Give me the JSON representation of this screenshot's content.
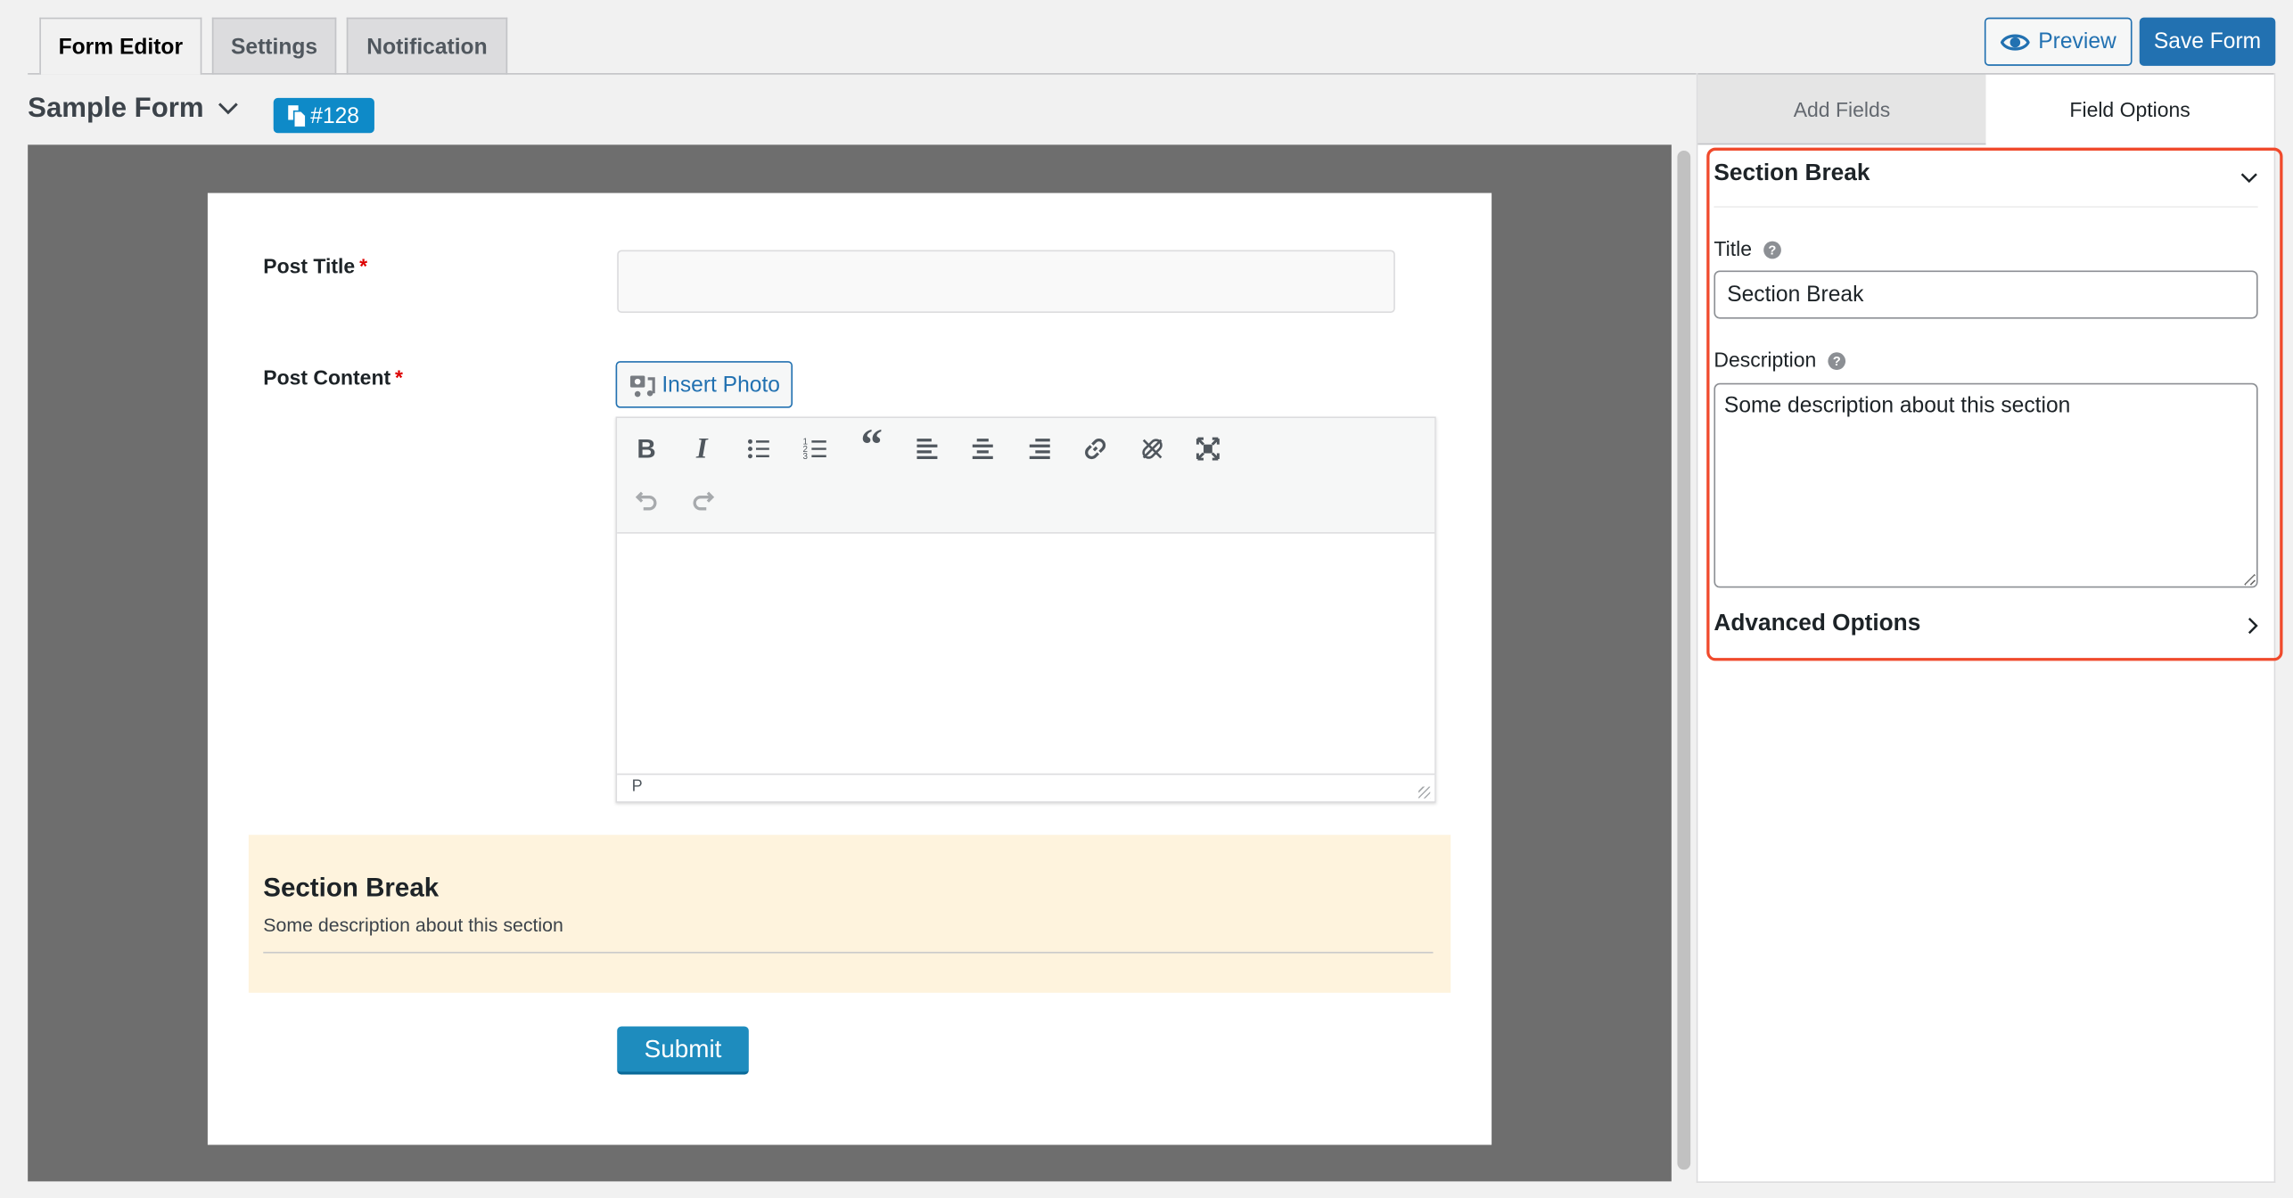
{
  "tabs": [
    {
      "label": "Form Editor",
      "active": true
    },
    {
      "label": "Settings",
      "active": false
    },
    {
      "label": "Notification",
      "active": false
    }
  ],
  "header": {
    "preview_label": "Preview",
    "save_label": "Save Form",
    "form_name": "Sample Form",
    "form_id": "#128"
  },
  "sidebar": {
    "tabs": [
      {
        "label": "Add Fields",
        "active": false
      },
      {
        "label": "Field Options",
        "active": true
      }
    ],
    "section_title": "Section Break",
    "title_label": "Title",
    "title_value": "Section Break",
    "description_label": "Description",
    "description_value": "Some description about this section",
    "advanced_label": "Advanced Options",
    "highlight_color": "#f04a2c"
  },
  "form": {
    "post_title_label": "Post Title",
    "post_title_value": "",
    "post_content_label": "Post Content",
    "required_mark": "*",
    "insert_photo_label": "Insert Photo",
    "editor_status": "P",
    "toolbar": [
      "bold",
      "italic",
      "bulleted-list",
      "numbered-list",
      "blockquote",
      "align-left",
      "align-center",
      "align-right",
      "link",
      "unlink",
      "fullscreen",
      "undo",
      "redo"
    ],
    "section_title": "Section Break",
    "section_description": "Some description about this section",
    "submit_label": "Submit"
  },
  "colors": {
    "primary": "#2271b1",
    "badge": "#0e8ac8",
    "submit": "#1e8cbe",
    "section_bg": "#fef3dd",
    "canvas": "#6e6e6e"
  }
}
